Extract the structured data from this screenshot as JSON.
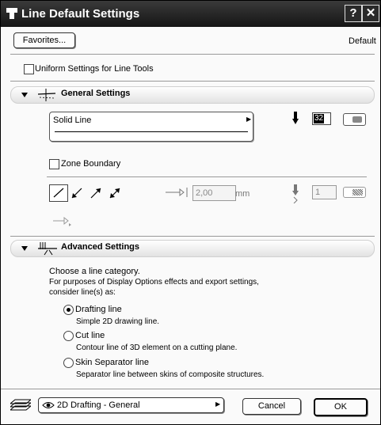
{
  "window": {
    "title": "Line Default Settings",
    "help": "?",
    "close": "✕"
  },
  "top": {
    "favorites_label": "Favorites...",
    "default_label": "Default"
  },
  "uniform": {
    "label": "Uniform Settings for Line Tools"
  },
  "general": {
    "title": "General Settings",
    "line_type": "Solid Line",
    "pen_number": "32",
    "zone_boundary_label": "Zone Boundary",
    "arrow_size_value": "2,00",
    "arrow_size_unit": "mm",
    "arrow_pen_value": "1"
  },
  "advanced": {
    "title": "Advanced Settings",
    "intro_1": "Choose a line category.",
    "intro_2": "For purposes of Display Options effects and export settings,",
    "intro_3": "consider line(s) as:",
    "options": [
      {
        "label": "Drafting line",
        "desc": "Simple 2D drawing line.",
        "selected": true
      },
      {
        "label": "Cut line",
        "desc": "Contour line of 3D element on a cutting plane.",
        "selected": false
      },
      {
        "label": "Skin Separator line",
        "desc": "Separator line between skins of composite structures.",
        "selected": false
      }
    ]
  },
  "footer": {
    "layer_label": "2D Drafting - General",
    "cancel_label": "Cancel",
    "ok_label": "OK"
  }
}
